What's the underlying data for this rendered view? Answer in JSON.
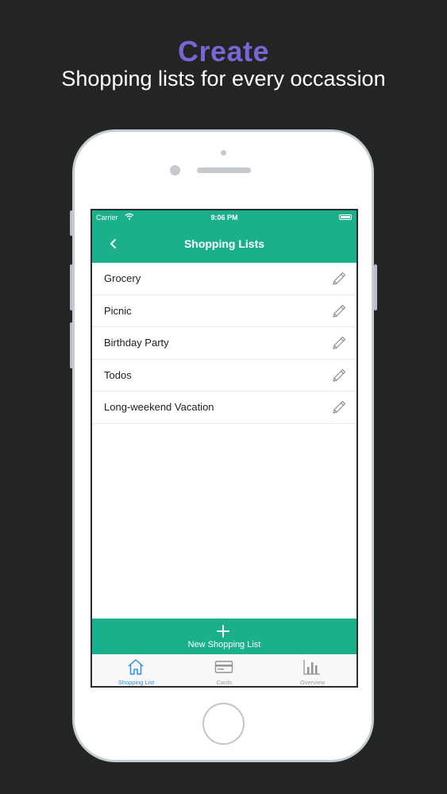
{
  "promo": {
    "headline": "Create",
    "subline": "Shopping lists for every occassion"
  },
  "status_bar": {
    "carrier": "Carrier",
    "time": "9:06 PM"
  },
  "nav": {
    "title": "Shopping Lists",
    "back_icon": "chevron-left-icon"
  },
  "lists": [
    {
      "label": "Grocery",
      "icon": "pencil-icon"
    },
    {
      "label": "Picnic",
      "icon": "pencil-icon"
    },
    {
      "label": "Birthday Party",
      "icon": "pencil-icon"
    },
    {
      "label": "Todos",
      "icon": "pencil-icon"
    },
    {
      "label": "Long-weekend Vacation",
      "icon": "pencil-icon"
    }
  ],
  "add_button": {
    "label": "New Shopping List",
    "icon": "plus-icon"
  },
  "tabs": [
    {
      "label": "Shopping List",
      "icon": "home-icon",
      "active": true
    },
    {
      "label": "Cards",
      "icon": "card-icon",
      "active": false
    },
    {
      "label": "Overview",
      "icon": "bar-chart-icon",
      "active": false
    }
  ],
  "colors": {
    "accent": "#1ab08c",
    "headline": "#7b64d4",
    "background": "#232424",
    "tab_active": "#2f8de0",
    "tab_inactive": "#9aa0a6"
  }
}
